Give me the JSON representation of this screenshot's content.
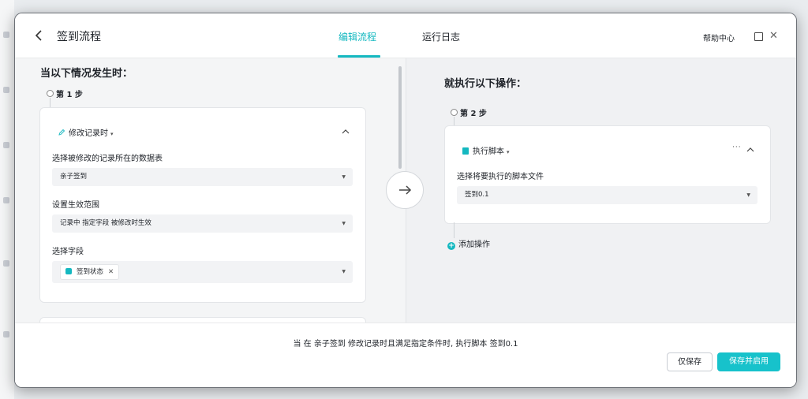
{
  "header": {
    "title": "签到流程",
    "tabs": [
      {
        "label": "编辑流程",
        "active": true
      },
      {
        "label": "运行日志",
        "active": false
      }
    ],
    "help_label": "帮助中心"
  },
  "trigger": {
    "section_title": "当以下情况发生时：",
    "step_label": "第 1 步",
    "type_label": "修改记录时",
    "table_field_label": "选择被修改的记录所在的数据表",
    "table_value": "亲子签到",
    "scope_field_label": "设置生效范围",
    "scope_value": "记录中 指定字段 被修改时生效",
    "field_select_label": "选择字段",
    "selected_field_tag": "签到状态"
  },
  "action": {
    "section_title": "就执行以下操作：",
    "step_label": "第 2 步",
    "type_label": "执行脚本",
    "script_field_label": "选择将要执行的脚本文件",
    "script_value": "签到0.1",
    "more_label": "···",
    "add_operation_label": "添加操作"
  },
  "footer": {
    "summary": "当 在 亲子签到 修改记录时且满足指定条件时, 执行脚本 签到0.1",
    "save_only_label": "仅保存",
    "save_enable_label": "保存并启用"
  },
  "colors": {
    "accent": "#14b8c0",
    "primary_button": "#17c2cb"
  },
  "icons": [
    "back-icon",
    "maximize-icon",
    "close-icon",
    "edit-icon",
    "chevron-up-icon",
    "arrow-right-icon",
    "script-icon",
    "plus-icon",
    "field-type-icon"
  ]
}
